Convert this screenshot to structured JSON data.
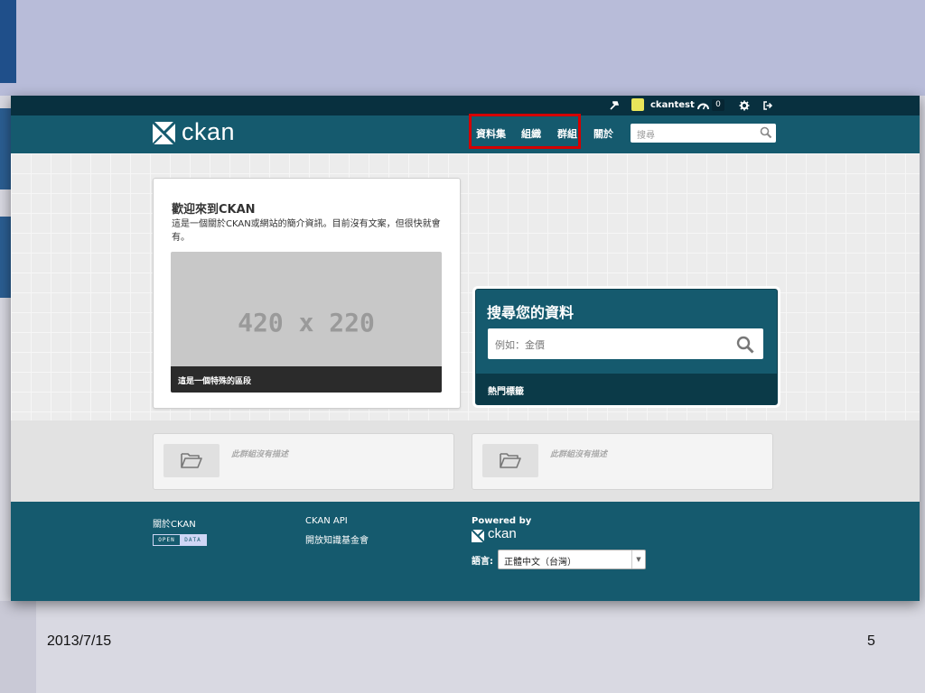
{
  "slide": {
    "date": "2013/7/15",
    "page_number": "5"
  },
  "account": {
    "username": "ckantest",
    "activity_count": "0"
  },
  "masthead": {
    "logo_text": "ckan",
    "nav": [
      "資料集",
      "組織",
      "群組",
      "關於"
    ],
    "search_placeholder": "搜尋"
  },
  "welcome": {
    "title": "歡迎來到CKAN",
    "text": "這是一個關於CKAN或網站的簡介資訊。目前沒有文案，但很快就會有。",
    "image_placeholder": "420 x 220",
    "caption": "這是一個特殊的區段"
  },
  "search_module": {
    "heading": "搜尋您的資料",
    "placeholder": "例如：金價",
    "popular_tags": "熱門標籤"
  },
  "groups": [
    {
      "description": "此群組沒有描述"
    },
    {
      "description": "此群組沒有描述"
    }
  ],
  "footer": {
    "about": "關於CKAN",
    "opendata_left": "OPEN",
    "opendata_right": "DATA",
    "api": "CKAN API",
    "foundation": "開放知識基金會",
    "powered_by": "Powered by",
    "logo_text": "ckan",
    "language_label": "語言:",
    "language_value": "正體中文（台灣）"
  },
  "colors": {
    "primary": "#155a6e",
    "account_bar": "#08303f",
    "highlight": "#d40000"
  }
}
